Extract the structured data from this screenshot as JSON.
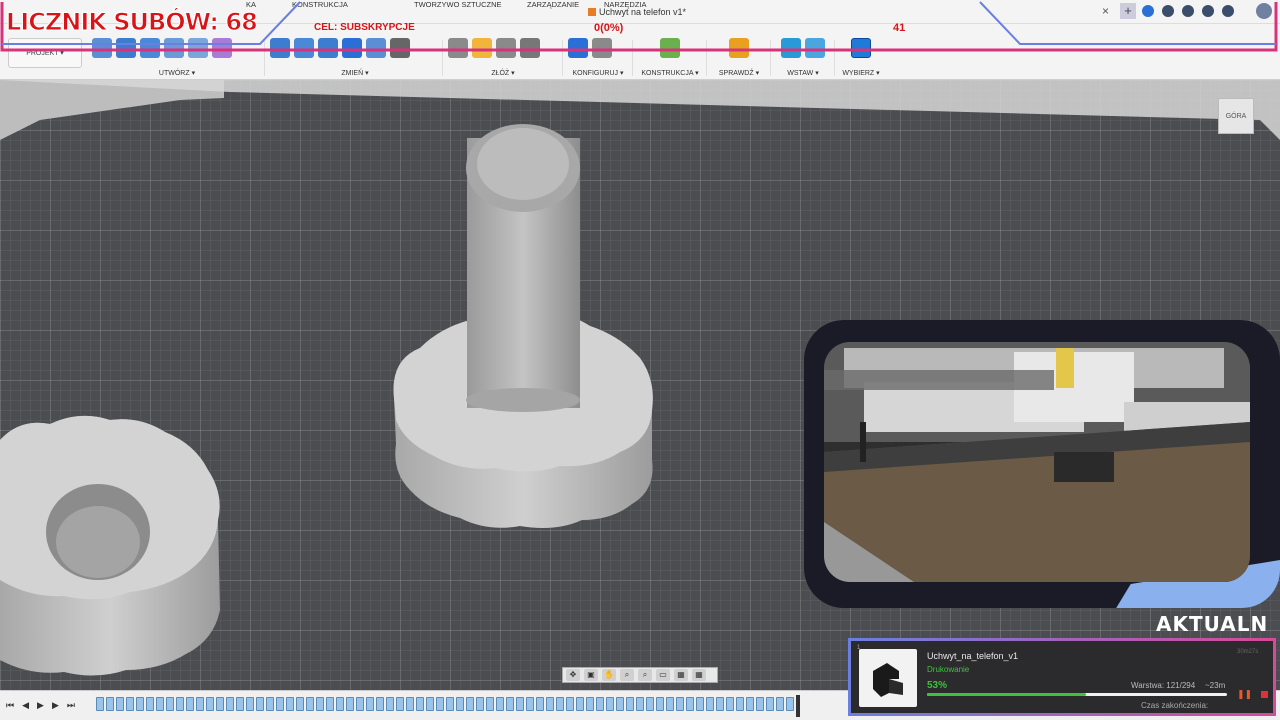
{
  "app": {
    "title": "Uchwyt na telefon v1*",
    "close_glyph": "×",
    "new_tab_glyph": "+"
  },
  "ribbon": {
    "project_label": "PROJEKT ▾",
    "tabs": [
      "KONSTRUKCJA",
      "TWORZYWO SZTUCZNE",
      "ZARZĄDZANIE",
      "NARZĘDZIA"
    ],
    "tab_partial_left": "KA",
    "groups": [
      {
        "label": "UTWÓRZ ▾"
      },
      {
        "label": "ZMIEŃ ▾"
      },
      {
        "label": "ZŁÓŻ ▾"
      },
      {
        "label": "KONFIGURUJ ▾"
      },
      {
        "label": "KONSTRUKCJA ▾"
      },
      {
        "label": "SPRAWDŹ ▾"
      },
      {
        "label": "WSTAW ▾"
      },
      {
        "label": "WYBIERZ ▾"
      }
    ]
  },
  "viewcube": {
    "label": "GÓRA"
  },
  "navbar": {
    "icons": [
      "✥",
      "▣",
      "✋",
      "⌕",
      "⌕",
      "▭",
      "▦",
      "▦"
    ]
  },
  "timeline": {
    "controls": [
      "⏮",
      "◀",
      "▶",
      "▶",
      "⏭"
    ],
    "item_count": 70
  },
  "overlay": {
    "sub_counter": "LICZNIK SUBÓW: 68",
    "goal_label": "CEL: SUBSKRYPCJE",
    "goal_value": "0(0%)",
    "goal_target": "41",
    "aktualn": "AKTUALN"
  },
  "print_card": {
    "index": "1",
    "name": "Uchwyt_na_telefon_v1",
    "status": "Drukowanie",
    "percent_text": "53%",
    "progress": 0.53,
    "layer": "Warstwa: 121/294",
    "time_left": "~23m",
    "end_label": "Czas zakończenia:",
    "corner": "30m27s",
    "pause_glyph": "❚❚"
  },
  "colors": {
    "accent_red": "#d81418",
    "progress_green": "#3cc23c",
    "frame_gradient_start": "#6a7fe0",
    "frame_gradient_end": "#d64a9a"
  }
}
